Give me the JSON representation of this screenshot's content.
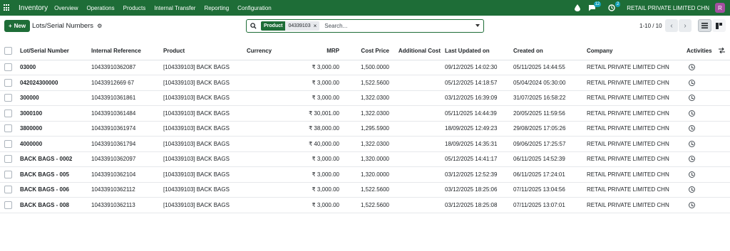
{
  "navbar": {
    "brand": "Inventory",
    "menu": [
      "Overview",
      "Operations",
      "Products",
      "Internal Transfer",
      "Reporting",
      "Configuration"
    ],
    "messages_count": "12",
    "activities_count": "2",
    "company": "RETAIL PRIVATE LIMITED CHN",
    "avatar_letter": "R",
    "bg_color": "#1e6d37"
  },
  "control": {
    "new_label": "New",
    "title": "Lots/Serial Numbers",
    "facet_label": "Product",
    "facet_value": "04339103",
    "search_placeholder": "Search...",
    "pager": "1-10 / 10"
  },
  "table": {
    "columns": [
      "Lot/Serial Number",
      "Internal Reference",
      "Product",
      "Currency",
      "MRP",
      "Cost Price",
      "Additional Cost",
      "Last Updated on",
      "Created on",
      "Company",
      "Activities"
    ],
    "rows": [
      [
        "03000",
        "10433910362087",
        "[104339103] BACK BAGS",
        "",
        "₹ 3,000.00",
        "1,500.0000",
        "",
        "09/12/2025 14:02:30",
        "05/11/2025 14:44:55",
        "RETAIL PRIVATE LIMITED CHN"
      ],
      [
        "042024300000",
        "10433912669 67",
        "[104339103] BACK BAGS",
        "",
        "₹ 3,000.00",
        "1,522.5600",
        "",
        "05/12/2025 14:18:57",
        "05/04/2024 05:30:00",
        "RETAIL PRIVATE LIMITED CHN"
      ],
      [
        "300000",
        "10433910361861",
        "[104339103] BACK BAGS",
        "",
        "₹ 3,000.00",
        "1,322.0300",
        "",
        "03/12/2025 16:39:09",
        "31/07/2025 16:58:22",
        "RETAIL PRIVATE LIMITED CHN"
      ],
      [
        "3000100",
        "10433910361484",
        "[104339103] BACK BAGS",
        "",
        "₹ 30,001.00",
        "1,322.0300",
        "",
        "05/11/2025 14:44:39",
        "20/05/2025 11:59:56",
        "RETAIL PRIVATE LIMITED CHN"
      ],
      [
        "3800000",
        "10433910361974",
        "[104339103] BACK BAGS",
        "",
        "₹ 38,000.00",
        "1,295.5900",
        "",
        "18/09/2025 12:49:23",
        "29/08/2025 17:05:26",
        "RETAIL PRIVATE LIMITED CHN"
      ],
      [
        "4000000",
        "10433910361794",
        "[104339103] BACK BAGS",
        "",
        "₹ 40,000.00",
        "1,322.0300",
        "",
        "18/09/2025 14:35:31",
        "09/06/2025 17:25:57",
        "RETAIL PRIVATE LIMITED CHN"
      ],
      [
        "BACK BAGS - 0002",
        "10433910362097",
        "[104339103] BACK BAGS",
        "",
        "₹ 3,000.00",
        "1,320.0000",
        "",
        "05/12/2025 14:41:17",
        "06/11/2025 14:52:39",
        "RETAIL PRIVATE LIMITED CHN"
      ],
      [
        "BACK BAGS - 005",
        "10433910362104",
        "[104339103] BACK BAGS",
        "",
        "₹ 3,000.00",
        "1,320.0000",
        "",
        "03/12/2025 12:52:39",
        "06/11/2025 17:24:01",
        "RETAIL PRIVATE LIMITED CHN"
      ],
      [
        "BACK BAGS - 006",
        "10433910362112",
        "[104339103] BACK BAGS",
        "",
        "₹ 3,000.00",
        "1,522.5600",
        "",
        "03/12/2025 18:25:06",
        "07/11/2025 13:04:56",
        "RETAIL PRIVATE LIMITED CHN"
      ],
      [
        "BACK BAGS - 008",
        "10433910362113",
        "[104339103] BACK BAGS",
        "",
        "₹ 3,000.00",
        "1,522.5600",
        "",
        "03/12/2025 18:25:08",
        "07/11/2025 13:07:01",
        "RETAIL PRIVATE LIMITED CHN"
      ]
    ]
  }
}
